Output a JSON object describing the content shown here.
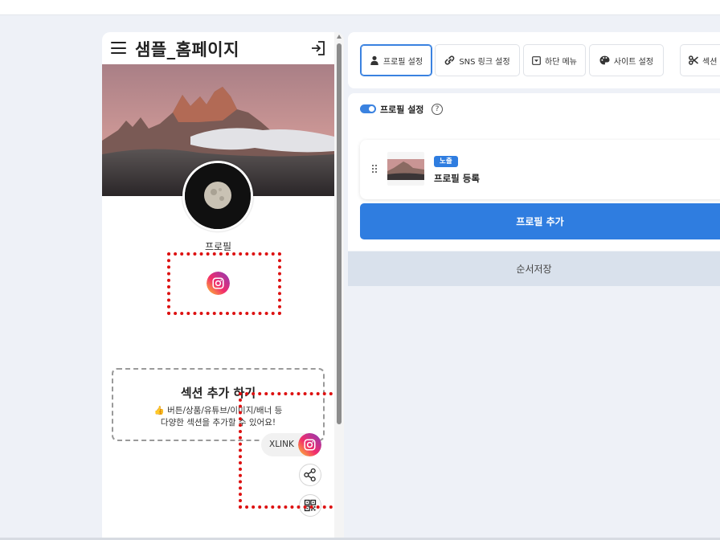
{
  "preview": {
    "site_title": "샘플_홈페이지",
    "profile_name": "프로필",
    "section_add": {
      "title": "섹션 추가 하기",
      "line1": "👍 버튼/상품/유튜브/이미지/배너 등",
      "line2": "다양한 섹션을 추가할 수 있어요!"
    },
    "xlink_label": "XLINK"
  },
  "tabs": [
    {
      "label": "프로필 설정",
      "icon": "person-icon",
      "active": true
    },
    {
      "label": "SNS 링크 설정",
      "icon": "link-icon",
      "active": false
    },
    {
      "label": "하단 메뉴",
      "icon": "dropdown-box-icon",
      "active": false
    },
    {
      "label": "사이트 설정",
      "icon": "palette-icon",
      "active": false
    },
    {
      "label": "섹션",
      "icon": "scissors-icon",
      "active": false
    }
  ],
  "profile_settings": {
    "label": "프로필 설정",
    "help": "?",
    "enabled": true,
    "items": [
      {
        "badge": "노출",
        "title": "프로필 등록"
      }
    ],
    "add_button": "프로필 추가",
    "save_button": "순서저장"
  },
  "colors": {
    "accent": "#2f7de0",
    "highlight_dotted": "#dd1111",
    "page_bg": "#eef1f7",
    "save_bg": "#d9e1ec"
  }
}
